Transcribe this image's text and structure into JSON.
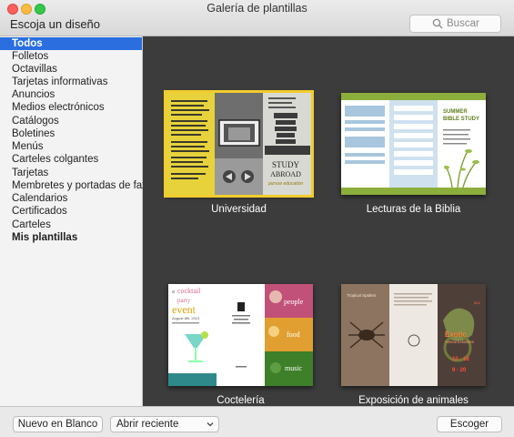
{
  "window": {
    "title": "Galería de plantillas",
    "subtitle": "Escoja un diseño"
  },
  "search": {
    "placeholder": "Buscar",
    "icon": "search-icon"
  },
  "sidebar": {
    "items": [
      {
        "label": "Todos",
        "active": true
      },
      {
        "label": "Folletos"
      },
      {
        "label": "Octavillas"
      },
      {
        "label": "Tarjetas informativas"
      },
      {
        "label": "Anuncios"
      },
      {
        "label": "Medios electrónicos"
      },
      {
        "label": "Catálogos"
      },
      {
        "label": "Boletines"
      },
      {
        "label": "Menús"
      },
      {
        "label": "Carteles colgantes"
      },
      {
        "label": "Tarjetas"
      },
      {
        "label": "Membretes y portadas de fax"
      },
      {
        "label": "Calendarios"
      },
      {
        "label": "Certificados"
      },
      {
        "label": "Carteles"
      },
      {
        "label": "Mis plantillas",
        "bold": true
      }
    ]
  },
  "templates": [
    {
      "label": "Universidad",
      "selected": true,
      "text": {
        "study": "STUDY",
        "abroad": "ABROAD",
        "tagline": "pursue education"
      }
    },
    {
      "label": "Lecturas de la Biblia",
      "text": {
        "summer": "SUMMER",
        "bible": "BIBLE STUDY"
      }
    },
    {
      "label": "Coctelería",
      "text": {
        "a": "a",
        "cocktail": "cocktail",
        "party": "party",
        "event": "event",
        "date": "August 8th, 2013",
        "people": "people",
        "food": "food",
        "music": "music"
      }
    },
    {
      "label": "Exposición de animales",
      "text": {
        "tropical": "Tropical Spiders",
        "exotic": "Exotic",
        "animal": "Animal Exhibition",
        "d1": "10 · 18",
        "d2": "9 · 20",
        "num": "$15"
      }
    }
  ],
  "footer": {
    "new_blank": "Nuevo en Blanco",
    "open_recent": "Abrir reciente",
    "choose": "Escoger"
  },
  "colors": {
    "accent": "#2a6ee0",
    "selection": "#f1cc2d",
    "gallery_bg": "#3c3c3c"
  }
}
